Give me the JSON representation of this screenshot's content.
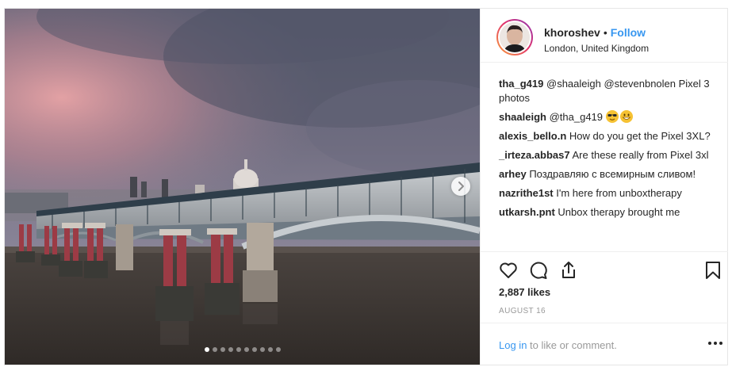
{
  "post": {
    "username": "khoroshev",
    "separator": "•",
    "follow_label": "Follow",
    "location": "London, United Kingdom",
    "carousel": {
      "slide_count": 10,
      "active_index": 0
    },
    "comments": [
      {
        "user": "tha_g419",
        "text": "@shaaleigh @stevenbnolen Pixel 3 photos"
      },
      {
        "user": "shaaleigh",
        "text": "@tha_g419",
        "emojis": [
          "smiling-face-with-sunglasses",
          "grinning-face"
        ]
      },
      {
        "user": "alexis_bello.n",
        "text": "How do you get the Pixel 3XL?"
      },
      {
        "user": "_irteza.abbas7",
        "text": "Are these really from Pixel 3xl"
      },
      {
        "user": "arhey",
        "text": "Поздравляю с всемирным сливом!"
      },
      {
        "user": "nazrithe1st",
        "text": "I'm here from unboxtherapy"
      },
      {
        "user": "utkarsh.pnt",
        "text": "Unbox therapy brought me"
      }
    ],
    "likes": "2,887 likes",
    "date": "AUGUST 16",
    "footer": {
      "login_label": "Log in",
      "login_suffix": "to like or comment."
    }
  },
  "icons": {
    "like": "heart-icon",
    "comment": "comment-bubble-icon",
    "share": "share-icon",
    "save": "bookmark-icon",
    "next": "chevron-right-icon",
    "more": "more-options-icon"
  },
  "colors": {
    "link_blue": "#3897f0",
    "muted_gray": "#999999",
    "text_dark": "#262626",
    "border": "#efefef"
  }
}
